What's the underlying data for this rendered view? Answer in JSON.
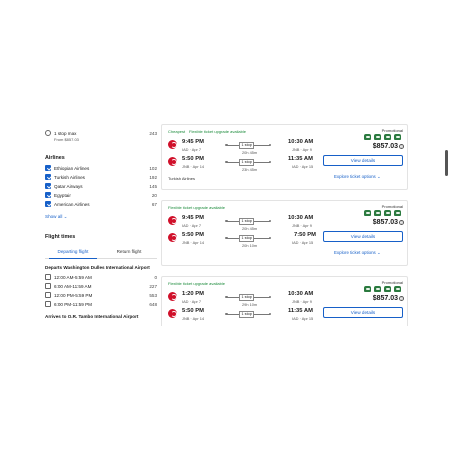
{
  "filters": {
    "one_stop": {
      "label": "1 stop max",
      "count": "243",
      "sub": "From $857.03"
    },
    "airlines_heading": "Airlines",
    "airlines": [
      {
        "label": "Ethiopian Airlines",
        "count": "102"
      },
      {
        "label": "Turkish Airlines",
        "count": "192"
      },
      {
        "label": "Qatar Airways",
        "count": "145"
      },
      {
        "label": "Egyptair",
        "count": "20"
      },
      {
        "label": "American Airlines",
        "count": "67"
      }
    ],
    "show_all": "Show all ⌄",
    "flight_times_heading": "Flight times",
    "tabs": [
      "Departing flight",
      "Return flight"
    ],
    "depart_heading": "Departs Washington Dulles International Airport",
    "depart_times": [
      {
        "label": "12:00 AM-5:59 AM",
        "count": "0"
      },
      {
        "label": "6:00 AM-11:59 AM",
        "count": "227"
      },
      {
        "label": "12:00 PM-5:59 PM",
        "count": "553"
      },
      {
        "label": "6:00 PM-11:59 PM",
        "count": "648"
      }
    ],
    "arrive_heading": "Arrives to O.R. Tambo International Airport"
  },
  "results": [
    {
      "tags": [
        "Cheapest",
        "Flexible ticket upgrade available"
      ],
      "segments": [
        {
          "dep_time": "9:45 PM",
          "dep_sub": "IAD · Apr 7",
          "stops": "1 stop",
          "duration": "20h 45m",
          "arr_time": "10:30 AM",
          "arr_sub": "JNB · Apr 9"
        },
        {
          "dep_time": "5:50 PM",
          "dep_sub": "JNB · Apr 14",
          "stops": "1 stop",
          "duration": "23h 45m",
          "arr_time": "11:35 AM",
          "arr_sub": "IAD · Apr 15"
        }
      ],
      "carrier": "Turkish Airlines",
      "promo": "Promotional",
      "price": "$857.03",
      "button": "View details",
      "explore": "Explore ticket options ⌄"
    },
    {
      "tags": [
        "Flexible ticket upgrade available"
      ],
      "segments": [
        {
          "dep_time": "9:45 PM",
          "dep_sub": "IAD · Apr 7",
          "stops": "1 stop",
          "duration": "20h 45m",
          "arr_time": "10:30 AM",
          "arr_sub": "JNB · Apr 9"
        },
        {
          "dep_time": "5:50 PM",
          "dep_sub": "JNB · Apr 14",
          "stops": "1 stop",
          "duration": "20h 10m",
          "arr_time": "7:50 PM",
          "arr_sub": "IAD · Apr 15"
        }
      ],
      "promo": "Promotional",
      "price": "$857.03",
      "button": "View details",
      "explore": "Explore ticket options ⌄"
    },
    {
      "tags": [
        "Flexible ticket upgrade available"
      ],
      "segments": [
        {
          "dep_time": "1:20 PM",
          "dep_sub": "IAD · Apr 7",
          "stops": "1 stop",
          "duration": "29h 10m",
          "arr_time": "10:30 AM",
          "arr_sub": "JNB · Apr 9"
        },
        {
          "dep_time": "5:50 PM",
          "dep_sub": "JNB · Apr 14",
          "stops": "1 stop",
          "duration": "",
          "arr_time": "11:35 AM",
          "arr_sub": "IAD · Apr 15"
        }
      ],
      "promo": "Promotional",
      "price": "$857.03",
      "button": "View details"
    }
  ]
}
